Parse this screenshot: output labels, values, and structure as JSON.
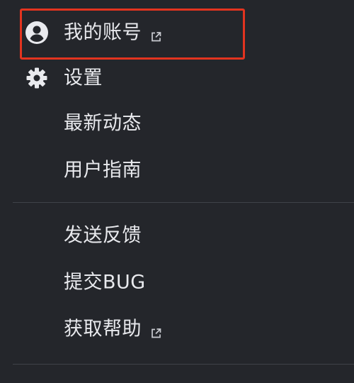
{
  "menu": {
    "items": [
      {
        "label": "我的账号",
        "icon": "account-circle-icon",
        "external": true
      },
      {
        "label": "设置",
        "icon": "gear-icon",
        "external": false
      },
      {
        "label": "最新动态",
        "icon": "",
        "external": false
      },
      {
        "label": "用户指南",
        "icon": "",
        "external": false
      },
      {
        "label": "发送反馈",
        "icon": "",
        "external": false
      },
      {
        "label": "提交BUG",
        "icon": "",
        "external": false
      },
      {
        "label": "获取帮助",
        "icon": "",
        "external": true
      }
    ],
    "highlight_item": "我的账号"
  },
  "colors": {
    "background": "#24262b",
    "text": "#e9eaee",
    "highlight_border": "#e3341f",
    "divider": "#3f4248"
  }
}
